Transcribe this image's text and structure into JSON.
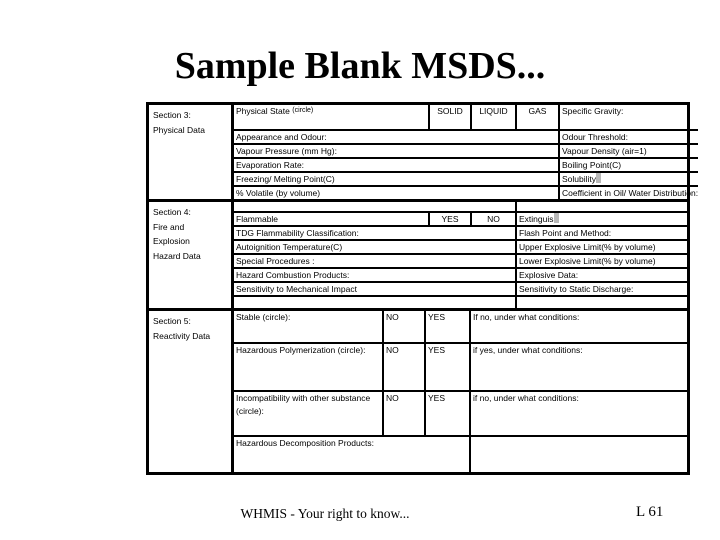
{
  "slide": {
    "title": "Sample Blank MSDS..."
  },
  "footer": {
    "note": "WHMIS - Your right to know...",
    "page": "L 61"
  },
  "sections": {
    "section3": {
      "label_line1": "Section 3:",
      "label_line2": "Physical Data",
      "physical_state_label": "Physical State",
      "physical_state_hint": "(circle)",
      "options": {
        "solid": "SOLID",
        "liquid": "LIQUID",
        "gas": "GAS"
      },
      "specific_gravity": "Specific Gravity:",
      "rows": [
        {
          "left": "Appearance and Odour:",
          "right": "Odour Threshold:"
        },
        {
          "left": "Vapour Pressure (mm Hg):",
          "right": "Vapour Density (air=1)"
        },
        {
          "left": "Evaporation Rate:",
          "right": "Boiling Point(C)"
        },
        {
          "left": "Freezing/ Melting Point(C)",
          "right": "Solubility"
        },
        {
          "left": "% Volatile (by volume)",
          "right": "Coefficient in Oil/ Water Distribution:"
        }
      ]
    },
    "section4": {
      "label_line1": "Section 4:",
      "label_line2": "Fire and",
      "label_line3": "Explosion",
      "label_line4": "Hazard Data",
      "flammable": "Flammable",
      "yes": "YES",
      "no": "NO",
      "extinguish": "Extinguis",
      "rows": [
        {
          "left": "TDG Flammability Classification:",
          "right": "Flash Point and Method:"
        },
        {
          "left": "Autoignition Temperature(C)",
          "right": "Upper Explosive Limit(% by volume)"
        },
        {
          "left": "Special Procedures :",
          "right": "Lower Explosive Limit(% by volume)"
        },
        {
          "left": "Hazard Combustion Products:",
          "right": "Explosive Data:"
        },
        {
          "left": "Sensitivity to Mechanical Impact",
          "right": "Sensitivity to Static Discharge:"
        }
      ]
    },
    "section5": {
      "label_line1": "Section 5:",
      "label_line2": "Reactivity Data",
      "rows": [
        {
          "label": "Stable (circle):",
          "no": "NO",
          "yes": "YES",
          "condition": "If no, under what conditions:"
        },
        {
          "label": "Hazardous Polymerization (circle):",
          "no": "NO",
          "yes": "YES",
          "condition": "if yes, under what conditions:"
        },
        {
          "label": "Incompatibility with other substance (circle):",
          "no": "NO",
          "yes": "YES",
          "condition": "if no, under what conditions:"
        }
      ],
      "decomposition": "Hazardous Decomposition Products:"
    }
  }
}
